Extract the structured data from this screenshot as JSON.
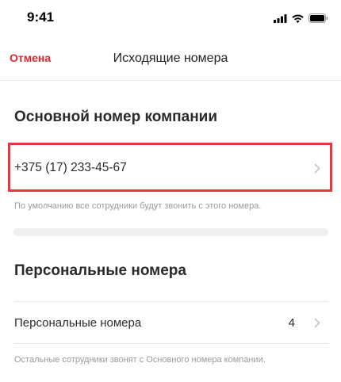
{
  "status_bar": {
    "time": "9:41",
    "icons": [
      "signal-icon",
      "wifi-icon",
      "battery-icon"
    ]
  },
  "nav": {
    "cancel_label": "Отмена",
    "title": "Исходящие номера",
    "accent_color": "#e3242b"
  },
  "company_section": {
    "title": "Основной номер компании",
    "phone": "+375 (17) 233-45-67",
    "hint": "По умолчанию все сотрудники будут звонить с этого номера.",
    "highlight_color": "#e8383d"
  },
  "personal_section": {
    "title": "Персональные номера",
    "row_label": "Персональные номера",
    "count": "4",
    "hint": "Остальные сотрудники звонят с Основного номера компании."
  }
}
